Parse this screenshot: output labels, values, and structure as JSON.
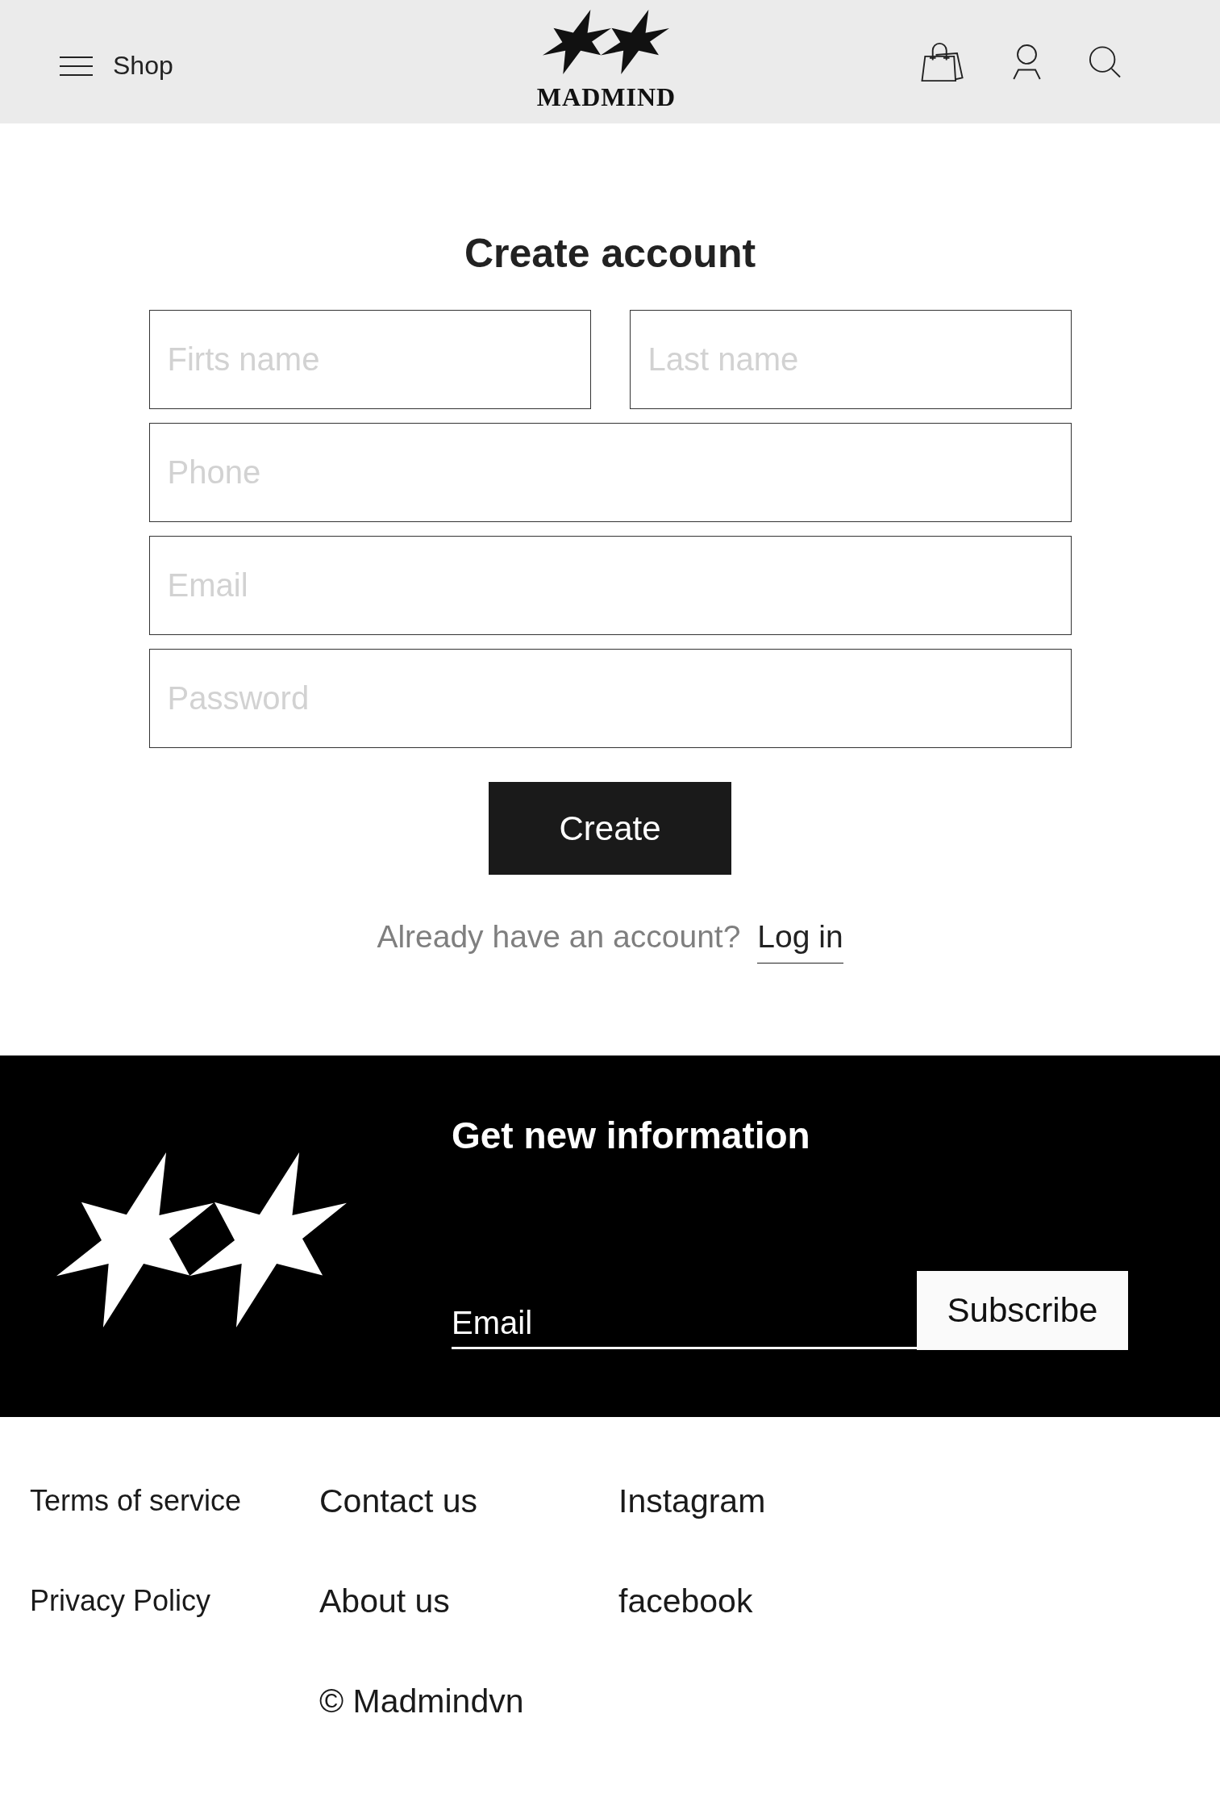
{
  "header": {
    "menu_label": "Shop",
    "brand": "MADMIND"
  },
  "form": {
    "title": "Create account",
    "fields": [
      {
        "placeholder": "Firts name"
      },
      {
        "placeholder": "Last name"
      },
      {
        "placeholder": "Phone"
      },
      {
        "placeholder": "Email"
      },
      {
        "placeholder": "Password"
      }
    ],
    "submit": "Create",
    "login_prompt": "Already have an account?",
    "login_link": "Log in"
  },
  "newsletter": {
    "title": "Get new information",
    "email_placeholder": "Email",
    "button": "Subscribe"
  },
  "footer": {
    "columns": [
      [
        "Terms of service",
        "Privacy Policy"
      ],
      [
        "Contact us",
        "About us"
      ],
      [
        "Instagram",
        "facebook"
      ]
    ],
    "copyright": "© Madmindvn"
  }
}
